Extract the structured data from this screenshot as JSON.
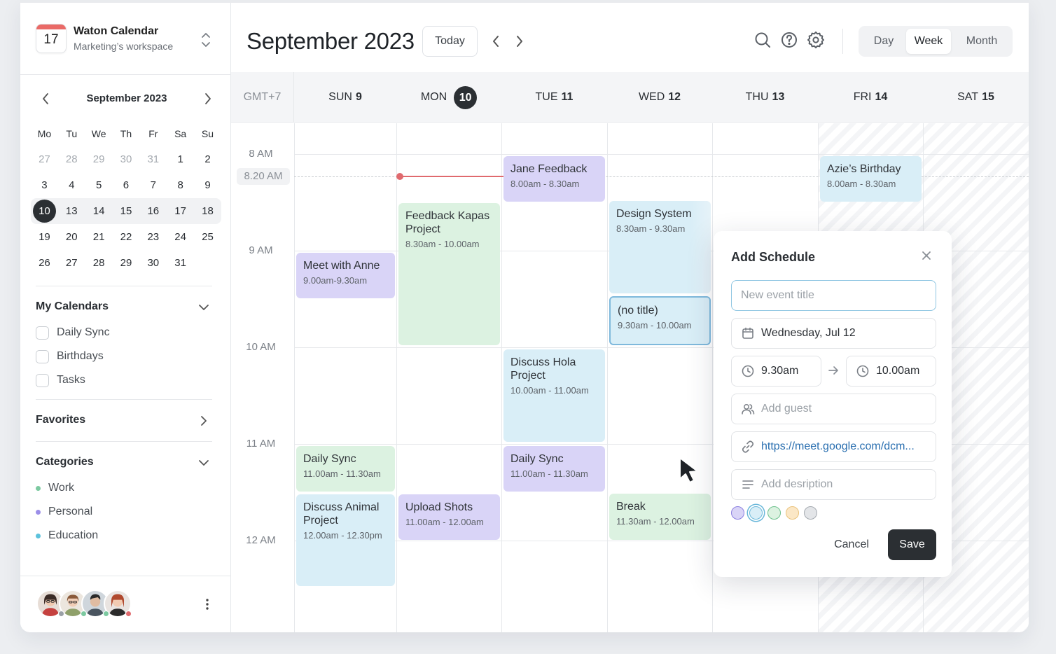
{
  "workspace": {
    "logo_day": "17",
    "name": "Waton Calendar",
    "subtitle": "Marketing’s workspace"
  },
  "mini_calendar": {
    "month_label": "September 2023",
    "weekdays": [
      "Mo",
      "Tu",
      "We",
      "Th",
      "Fr",
      "Sa",
      "Su"
    ],
    "weeks": [
      [
        "27",
        "28",
        "29",
        "30",
        "31",
        "1",
        "2"
      ],
      [
        "3",
        "4",
        "5",
        "6",
        "7",
        "8",
        "9"
      ],
      [
        "10",
        "13",
        "14",
        "15",
        "16",
        "17",
        "18"
      ],
      [
        "19",
        "20",
        "21",
        "22",
        "23",
        "24",
        "25"
      ],
      [
        "26",
        "27",
        "28",
        "29",
        "30",
        "31",
        ""
      ]
    ],
    "selected_day": "10"
  },
  "my_calendars": {
    "title": "My Calendars",
    "items": [
      "Daily Sync",
      "Birthdays",
      "Tasks"
    ]
  },
  "favorites": {
    "title": "Favorites"
  },
  "categories": {
    "title": "Categories",
    "items": [
      {
        "label": "Work",
        "color": "#7cc9a0"
      },
      {
        "label": "Personal",
        "color": "#9b8ee8"
      },
      {
        "label": "Education",
        "color": "#5cc2dc"
      }
    ]
  },
  "header": {
    "title": "September 2023",
    "today_label": "Today",
    "views": [
      "Day",
      "Week",
      "Month"
    ],
    "active_view": "Week"
  },
  "grid": {
    "timezone": "GMT+7",
    "days": [
      {
        "dow": "SUN",
        "num": "9"
      },
      {
        "dow": "MON",
        "num": "10"
      },
      {
        "dow": "TUE",
        "num": "11"
      },
      {
        "dow": "WED",
        "num": "12"
      },
      {
        "dow": "THU",
        "num": "13"
      },
      {
        "dow": "FRI",
        "num": "14"
      },
      {
        "dow": "SAT",
        "num": "15"
      }
    ],
    "hours": [
      "8 AM",
      "9 AM",
      "10 AM",
      "11 AM",
      "12 AM"
    ],
    "now_label": "8.20 AM"
  },
  "events": [
    {
      "title": "Jane Feedback",
      "time": "8.00am - 8.30am",
      "color": "purple"
    },
    {
      "title": "Azie’s Birthday",
      "time": "8.00am - 8.30am",
      "color": "blue"
    },
    {
      "title": "Feedback Kapas Project",
      "time": "8.30am - 10.00am",
      "color": "green"
    },
    {
      "title": "Design System",
      "time": "8.30am - 9.30am",
      "color": "blue"
    },
    {
      "title": "Meet with Anne",
      "time": "9.00am-9.30am",
      "color": "purple"
    },
    {
      "title": "(no title)",
      "time": "9.30am - 10.00am",
      "color": "blue-selected"
    },
    {
      "title": "Discuss Hola Project",
      "time": "10.00am - 11.00am",
      "color": "blue"
    },
    {
      "title": "Daily Sync",
      "time": "11.00am - 11.30am",
      "color": "green"
    },
    {
      "title": "Daily Sync",
      "time": "11.00am - 11.30am",
      "color": "purple"
    },
    {
      "title": "Discuss Animal Project",
      "time": "12.00am - 12.30pm",
      "color": "blue"
    },
    {
      "title": "Upload Shots",
      "time": "11.00am - 12.00am",
      "color": "purple"
    },
    {
      "title": "Break",
      "time": "11.30am - 12.00am",
      "color": "green"
    }
  ],
  "modal": {
    "title": "Add Schedule",
    "title_placeholder": "New event title",
    "date": "Wednesday, Jul 12",
    "start_time": "9.30am",
    "end_time": "10.00am",
    "guest_placeholder": "Add guest",
    "link": "https://meet.google.com/dcm...",
    "description_placeholder": "Add desription",
    "swatches": [
      "#d9d4f7",
      "#d9eef7",
      "#dcf2e1",
      "#fbe7c6",
      "#e3e5e8"
    ],
    "selected_swatch": "#d9eef7",
    "cancel_label": "Cancel",
    "save_label": "Save"
  }
}
